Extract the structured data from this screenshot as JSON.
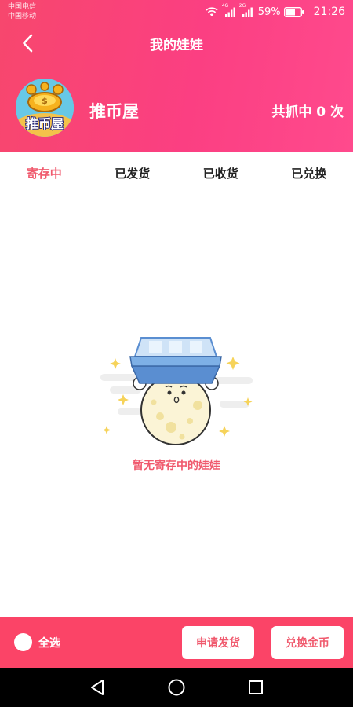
{
  "status_bar": {
    "carrier_1": "中国电信",
    "carrier_2": "中国移动",
    "net_1": "4G",
    "net_2": "2G",
    "battery": "59%",
    "time": "21:26"
  },
  "nav": {
    "title": "我的娃娃"
  },
  "profile": {
    "avatar_text": "推币屋",
    "name": "推币屋",
    "catch_count": "共抓中 0 次"
  },
  "tabs": [
    {
      "label": "寄存中",
      "active": true
    },
    {
      "label": "已发货",
      "active": false
    },
    {
      "label": "已收货",
      "active": false
    },
    {
      "label": "已兑换",
      "active": false
    }
  ],
  "empty": {
    "message": "暂无寄存中的娃娃"
  },
  "bottom": {
    "select_all": "全选",
    "apply_button": "申请发货",
    "exchange_button": "兑换金币"
  },
  "colors": {
    "accent": "#f05a6e",
    "header_start": "#f7476d",
    "header_end": "#ff4a8d",
    "bottom_bar": "#fb4467"
  }
}
